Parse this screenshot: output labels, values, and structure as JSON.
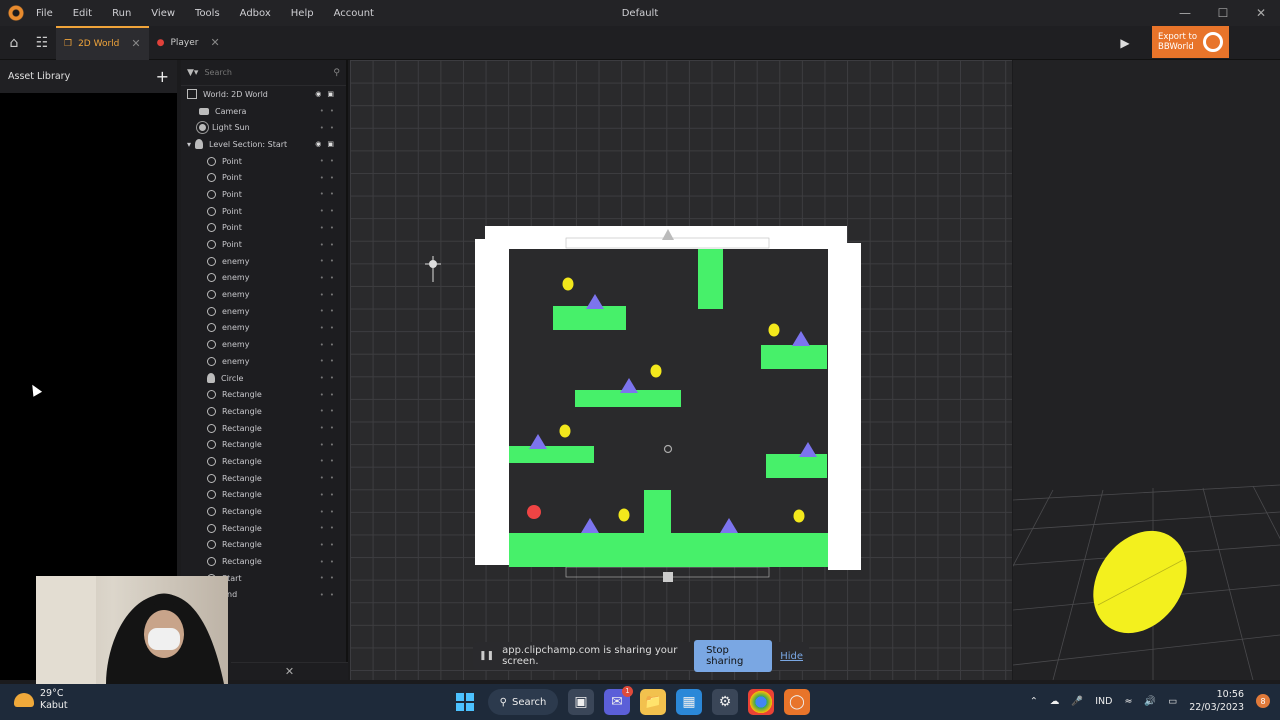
{
  "menubar": {
    "items": [
      "File",
      "Edit",
      "Run",
      "View",
      "Tools",
      "Adbox",
      "Help",
      "Account"
    ],
    "title": "Default"
  },
  "tabs": [
    {
      "label": "2D World",
      "active": true
    },
    {
      "label": "Player",
      "active": false
    }
  ],
  "export": {
    "label_line1": "Export to",
    "label_line2": "BBWorld"
  },
  "asset_library": {
    "title": "Asset Library"
  },
  "scene_tree": {
    "search_placeholder": "Search",
    "items": [
      {
        "label": "World: 2D World",
        "icon": "world-icon",
        "depth": 0,
        "visible": true
      },
      {
        "label": "Camera",
        "icon": "camera-icon",
        "depth": 1,
        "visible": false
      },
      {
        "label": "Light Sun",
        "icon": "sun-icon",
        "depth": 1,
        "visible": false
      },
      {
        "label": "Level Section: Start",
        "icon": "person-icon",
        "depth": 0,
        "visible": true,
        "expanded": true
      },
      {
        "label": "Point",
        "icon": "circle-icon",
        "depth": 2
      },
      {
        "label": "Point",
        "icon": "circle-icon",
        "depth": 2
      },
      {
        "label": "Point",
        "icon": "circle-icon",
        "depth": 2
      },
      {
        "label": "Point",
        "icon": "circle-icon",
        "depth": 2
      },
      {
        "label": "Point",
        "icon": "circle-icon",
        "depth": 2
      },
      {
        "label": "Point",
        "icon": "circle-icon",
        "depth": 2
      },
      {
        "label": "enemy",
        "icon": "circle-icon",
        "depth": 2
      },
      {
        "label": "enemy",
        "icon": "circle-icon",
        "depth": 2
      },
      {
        "label": "enemy",
        "icon": "circle-icon",
        "depth": 2
      },
      {
        "label": "enemy",
        "icon": "circle-icon",
        "depth": 2
      },
      {
        "label": "enemy",
        "icon": "circle-icon",
        "depth": 2
      },
      {
        "label": "enemy",
        "icon": "circle-icon",
        "depth": 2
      },
      {
        "label": "enemy",
        "icon": "circle-icon",
        "depth": 2
      },
      {
        "label": "Circle",
        "icon": "person-icon",
        "depth": 2
      },
      {
        "label": "Rectangle",
        "icon": "circle-icon",
        "depth": 2
      },
      {
        "label": "Rectangle",
        "icon": "circle-icon",
        "depth": 2
      },
      {
        "label": "Rectangle",
        "icon": "circle-icon",
        "depth": 2
      },
      {
        "label": "Rectangle",
        "icon": "circle-icon",
        "depth": 2
      },
      {
        "label": "Rectangle",
        "icon": "circle-icon",
        "depth": 2
      },
      {
        "label": "Rectangle",
        "icon": "circle-icon",
        "depth": 2
      },
      {
        "label": "Rectangle",
        "icon": "circle-icon",
        "depth": 2
      },
      {
        "label": "Rectangle",
        "icon": "circle-icon",
        "depth": 2
      },
      {
        "label": "Rectangle",
        "icon": "circle-icon",
        "depth": 2
      },
      {
        "label": "Rectangle",
        "icon": "circle-icon",
        "depth": 2
      },
      {
        "label": "Rectangle",
        "icon": "circle-icon",
        "depth": 2
      },
      {
        "label": "Start",
        "icon": "circle-icon",
        "depth": 2
      },
      {
        "label": "End",
        "icon": "circle-icon",
        "depth": 2
      }
    ]
  },
  "colors": {
    "platform": "#47f06a",
    "wall": "#ffffff",
    "enemy": "#7c74ee",
    "coin": "#f3e81c",
    "player": "#ef4444",
    "accent": "#f0a43a",
    "export": "#e8742a"
  },
  "share_bar": {
    "message": "app.clipchamp.com is sharing your screen.",
    "stop_label": "Stop sharing",
    "hide_label": "Hide"
  },
  "taskbar": {
    "temperature": "29°C",
    "weather": "Kabut",
    "search_label": "Search",
    "language": "IND",
    "time": "10:56",
    "date": "22/03/2023",
    "notifications": "8",
    "chat_badge": "1"
  }
}
